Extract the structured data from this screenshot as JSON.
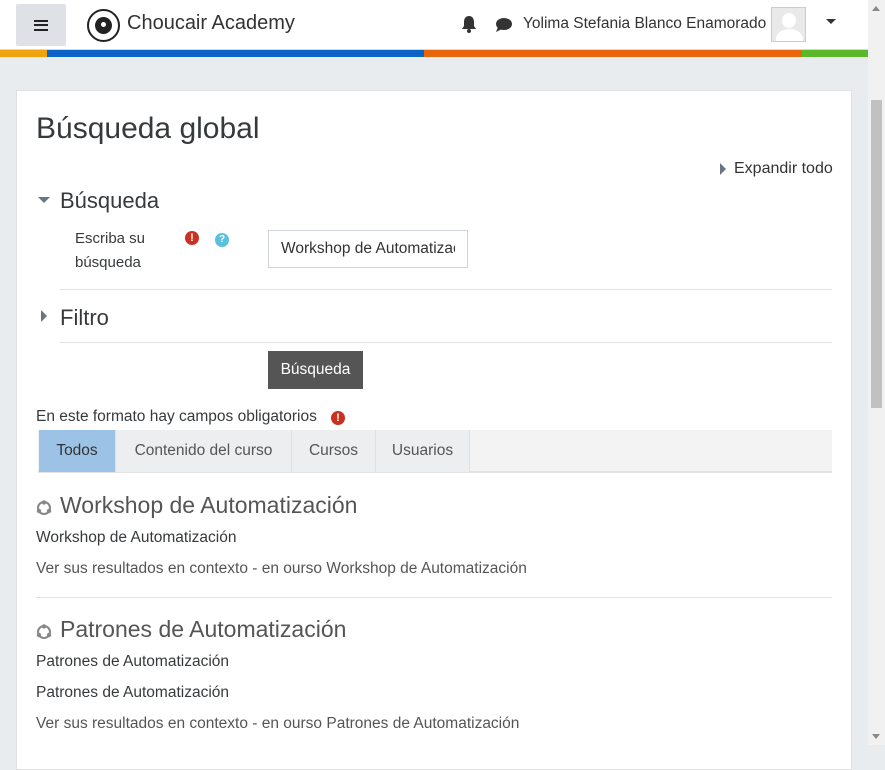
{
  "header": {
    "site_name": "Choucair Academy",
    "user_name": "Yolima Stefania Blanco Enamorado",
    "icons": [
      "menu-icon",
      "bell-icon",
      "chat-icon",
      "avatar",
      "caret-down-icon"
    ],
    "color_bar": [
      "#f0a30a",
      "#0a64c8",
      "#e8670b",
      "#5bb82a"
    ]
  },
  "page": {
    "title": "Búsqueda global",
    "expand_all": "Expandir todo",
    "search_section": "Búsqueda",
    "search_label": "Escriba su búsqueda",
    "search_value": "Workshop de Automatización",
    "filter_section": "Filtro",
    "search_button": "Búsqueda",
    "required_note": "En este formato hay campos obligatorios"
  },
  "tabs": [
    {
      "label": "Todos",
      "active": true
    },
    {
      "label": "Contenido del curso",
      "active": false
    },
    {
      "label": "Cursos",
      "active": false
    },
    {
      "label": "Usuarios",
      "active": false
    }
  ],
  "results": [
    {
      "title": "Workshop de Automatización",
      "lines": [
        "Workshop de Automatización"
      ],
      "context": "Ver sus resultados en contexto - en ourso Workshop de Automatización"
    },
    {
      "title": "Patrones de Automatización",
      "lines": [
        "Patrones de Automatización",
        "Patrones de Automatización"
      ],
      "context": "Ver sus resultados en contexto - en ourso Patrones de Automatización"
    }
  ]
}
